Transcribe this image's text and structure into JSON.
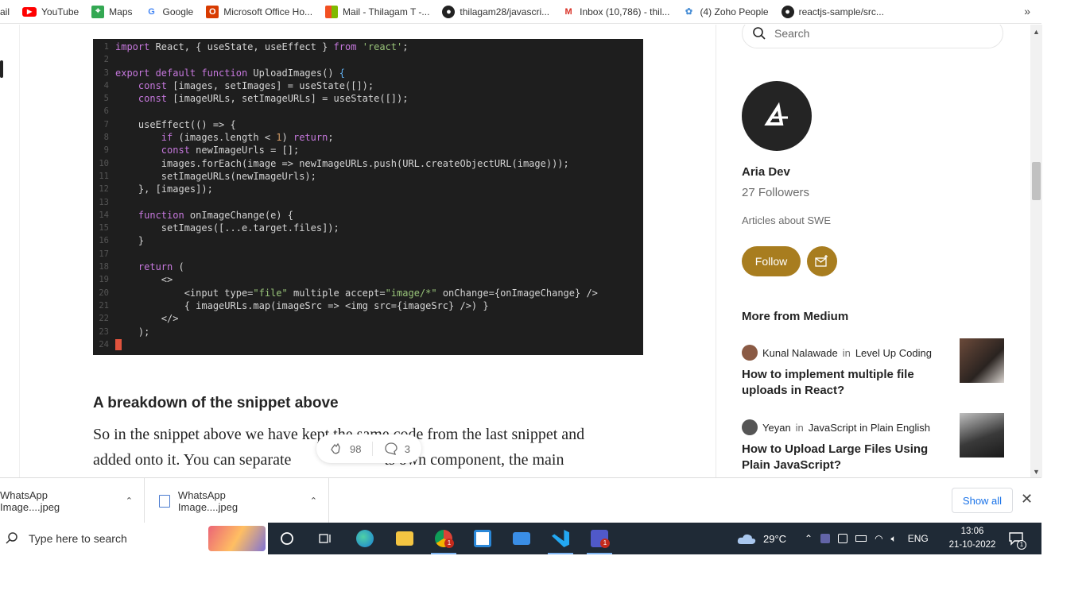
{
  "bookmarks": [
    {
      "label": "ail",
      "icon": "mail-icon"
    },
    {
      "label": "YouTube",
      "icon": "youtube-icon"
    },
    {
      "label": "Maps",
      "icon": "maps-icon"
    },
    {
      "label": "Google",
      "icon": "google-icon"
    },
    {
      "label": "Microsoft Office Ho...",
      "icon": "office-icon"
    },
    {
      "label": "Mail - Thilagam T -...",
      "icon": "microsoft-icon"
    },
    {
      "label": "thilagam28/javascri...",
      "icon": "github-icon"
    },
    {
      "label": "Inbox (10,786) - thil...",
      "icon": "gmail-icon"
    },
    {
      "label": "(4) Zoho People",
      "icon": "zoho-icon"
    },
    {
      "label": "reactjs-sample/src...",
      "icon": "github-icon"
    }
  ],
  "bookmarks_overflow": "»",
  "code": {
    "lines": [
      {
        "n": "1",
        "html": "<span class='kw'>import</span> React, { useState, useEffect } <span class='kw'>from</span> <span class='str'>'react'</span>;"
      },
      {
        "n": "2",
        "html": ""
      },
      {
        "n": "3",
        "html": "<span class='kw'>export default function</span> UploadImages() <span style='color:#61afef'>{</span>"
      },
      {
        "n": "4",
        "html": "    <span class='kw'>const</span> [images, setImages] = useState([]);"
      },
      {
        "n": "5",
        "html": "    <span class='kw'>const</span> [imageURLs, setImageURLs] = useState([]);"
      },
      {
        "n": "6",
        "html": ""
      },
      {
        "n": "7",
        "html": "    useEffect(() =&gt; {"
      },
      {
        "n": "8",
        "html": "        <span class='kw'>if</span> (images.length &lt; <span class='num'>1</span>) <span class='kw'>return</span>;"
      },
      {
        "n": "9",
        "html": "        <span class='kw'>const</span> newImageUrls = [];"
      },
      {
        "n": "10",
        "html": "        images.forEach(image =&gt; newImageURLs.push(URL.createObjectURL(image)));"
      },
      {
        "n": "11",
        "html": "        setImageURLs(newImageUrls);"
      },
      {
        "n": "12",
        "html": "    }, [images]);"
      },
      {
        "n": "13",
        "html": ""
      },
      {
        "n": "14",
        "html": "    <span class='kw'>function</span> onImageChange(e) {"
      },
      {
        "n": "15",
        "html": "        setImages([...e.target.files]);"
      },
      {
        "n": "16",
        "html": "    }"
      },
      {
        "n": "17",
        "html": ""
      },
      {
        "n": "18",
        "html": "    <span class='kw'>return</span> ("
      },
      {
        "n": "19",
        "html": "        &lt;&gt;"
      },
      {
        "n": "20",
        "html": "            &lt;input type=<span class='str'>\"file\"</span> multiple accept=<span class='str'>\"image/*\"</span> onChange={onImageChange} /&gt;"
      },
      {
        "n": "21",
        "html": "            { imageURLs.map(imageSrc =&gt; &lt;img src={imageSrc} /&gt;) }"
      },
      {
        "n": "22",
        "html": "        &lt;/&gt;"
      },
      {
        "n": "23",
        "html": "    );"
      },
      {
        "n": "24",
        "html": "<span class='cursor'></span>"
      }
    ]
  },
  "article": {
    "heading": "A breakdown of the snippet above",
    "para_line1": "So in the snippet above we have kept the same code from the last snippet and",
    "para_line2": "added onto it. You can separate",
    "para_line2_end": "ts own component, the main",
    "claps": "98",
    "responses": "3"
  },
  "sidebar": {
    "search_placeholder": "Search",
    "author_name": "Aria Dev",
    "followers": "27 Followers",
    "bio": "Articles about SWE",
    "follow_label": "Follow",
    "more_title": "More from Medium",
    "recommendations": [
      {
        "author": "Kunal Nalawade",
        "in": "in",
        "publication": "Level Up Coding",
        "title": "How to implement multiple file uploads in React?"
      },
      {
        "author": "Yeyan",
        "in": "in",
        "publication": "JavaScript in Plain English",
        "title": "How to Upload Large Files Using Plain JavaScript?"
      }
    ]
  },
  "downloads": {
    "items": [
      {
        "name": "WhatsApp Image....jpeg"
      },
      {
        "name": "WhatsApp Image....jpeg"
      }
    ],
    "show_all": "Show all"
  },
  "taskbar": {
    "search_placeholder": "Type here to search",
    "weather": "29°C",
    "language": "ENG",
    "time": "13:06",
    "date": "21-10-2022",
    "notification_count": "1",
    "chrome_badge": "1",
    "teams_badge": "1"
  }
}
